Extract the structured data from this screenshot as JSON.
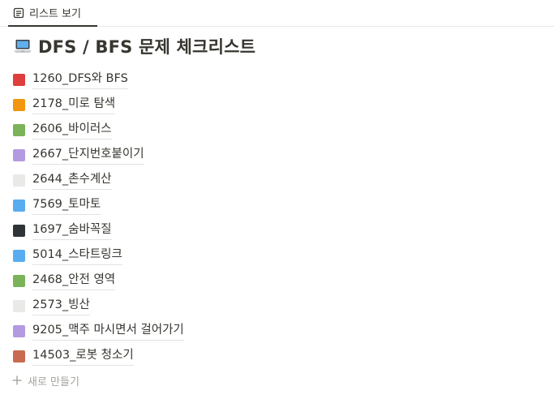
{
  "tab": {
    "label": "리스트 보기",
    "icon": "list-view-icon"
  },
  "page": {
    "title": "DFS / BFS 문제 체크리스트",
    "icon": "laptop-icon"
  },
  "items": [
    {
      "label": "1260_DFS와 BFS",
      "color": "#e03e3e"
    },
    {
      "label": "2178_미로 탐색",
      "color": "#f2960f"
    },
    {
      "label": "2606_바이러스",
      "color": "#7ab35a"
    },
    {
      "label": "2667_단지번호붙이기",
      "color": "#b49ae0"
    },
    {
      "label": "2644_촌수계산",
      "color": "#e9e9e7"
    },
    {
      "label": "7569_토마토",
      "color": "#5aacf0"
    },
    {
      "label": "1697_숨바꼭질",
      "color": "#2f3437"
    },
    {
      "label": "5014_스타트링크",
      "color": "#5aacf0"
    },
    {
      "label": "2468_안전 영역",
      "color": "#7ab35a"
    },
    {
      "label": "2573_빙산",
      "color": "#e9e9e7"
    },
    {
      "label": "9205_맥주 마시면서 걸어가기",
      "color": "#b49ae0"
    },
    {
      "label": "14503_로봇 청소기",
      "color": "#c96b52"
    }
  ],
  "new_item": {
    "label": "새로 만들기",
    "icon": "plus-icon"
  }
}
